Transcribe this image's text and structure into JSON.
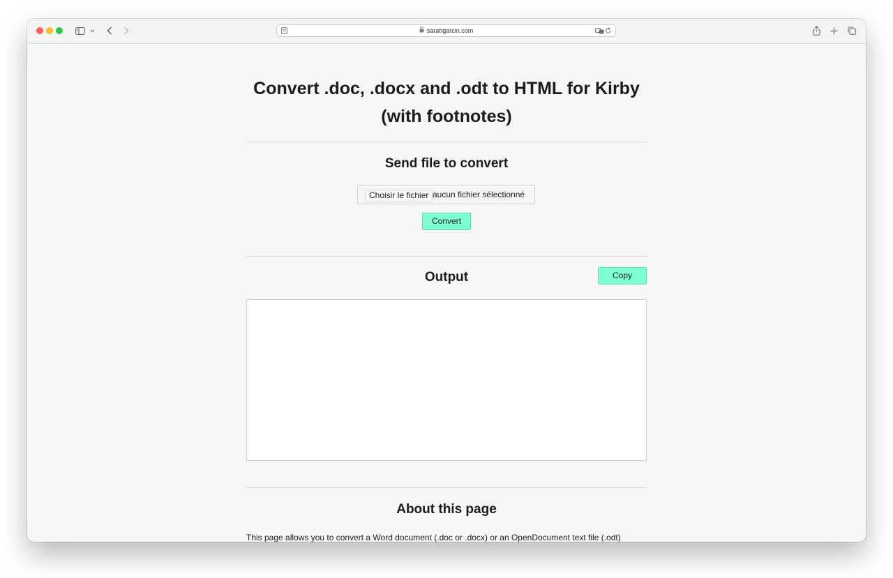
{
  "browser": {
    "url": "sarahgarcin.com",
    "icons": {
      "sidebar": "sidebar-icon",
      "back": "chevron-left-icon",
      "forward": "chevron-right-icon",
      "reader": "reader-icon",
      "lock": "lock-icon",
      "translate": "translate-icon",
      "reload": "reload-icon",
      "share": "share-icon",
      "new_tab": "plus-icon",
      "tabs": "tabs-overview-icon"
    }
  },
  "page": {
    "title": "Convert .doc, .docx and .odt to HTML for Kirby (with footnotes)",
    "send_section": {
      "heading": "Send file to convert",
      "file_button": "Choisir le fichier",
      "file_status": "aucun fichier sélectionné",
      "convert_label": "Convert"
    },
    "output_section": {
      "heading": "Output",
      "copy_label": "Copy",
      "output_value": ""
    },
    "about_section": {
      "heading": "About this page",
      "text": "This page allows you to convert a Word document (.doc or .docx) or an OpenDocument text file (.odt)"
    }
  },
  "colors": {
    "accent_button": "#7fffd4",
    "page_background": "#f6f6f6",
    "text": "#1c1c1c"
  }
}
